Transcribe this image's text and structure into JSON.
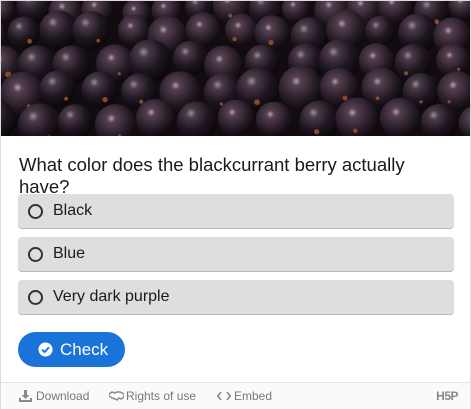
{
  "image": {
    "alt_icon": "blackcurrant-berries-photo"
  },
  "question": "What color does the blackcurrant berry actually have?",
  "answers": [
    {
      "label": "Black"
    },
    {
      "label": "Blue"
    },
    {
      "label": "Very dark purple"
    }
  ],
  "check_button": {
    "label": "Check",
    "icon": "check-circle-icon",
    "color": "#1a73d9"
  },
  "footer": {
    "download": "Download",
    "rights": "Rights of use",
    "embed": "Embed",
    "logo": "H5P"
  },
  "colors": {
    "answer_bg": "#dedede",
    "footer_bg": "#fafafa",
    "text": "#1a1a1a"
  }
}
